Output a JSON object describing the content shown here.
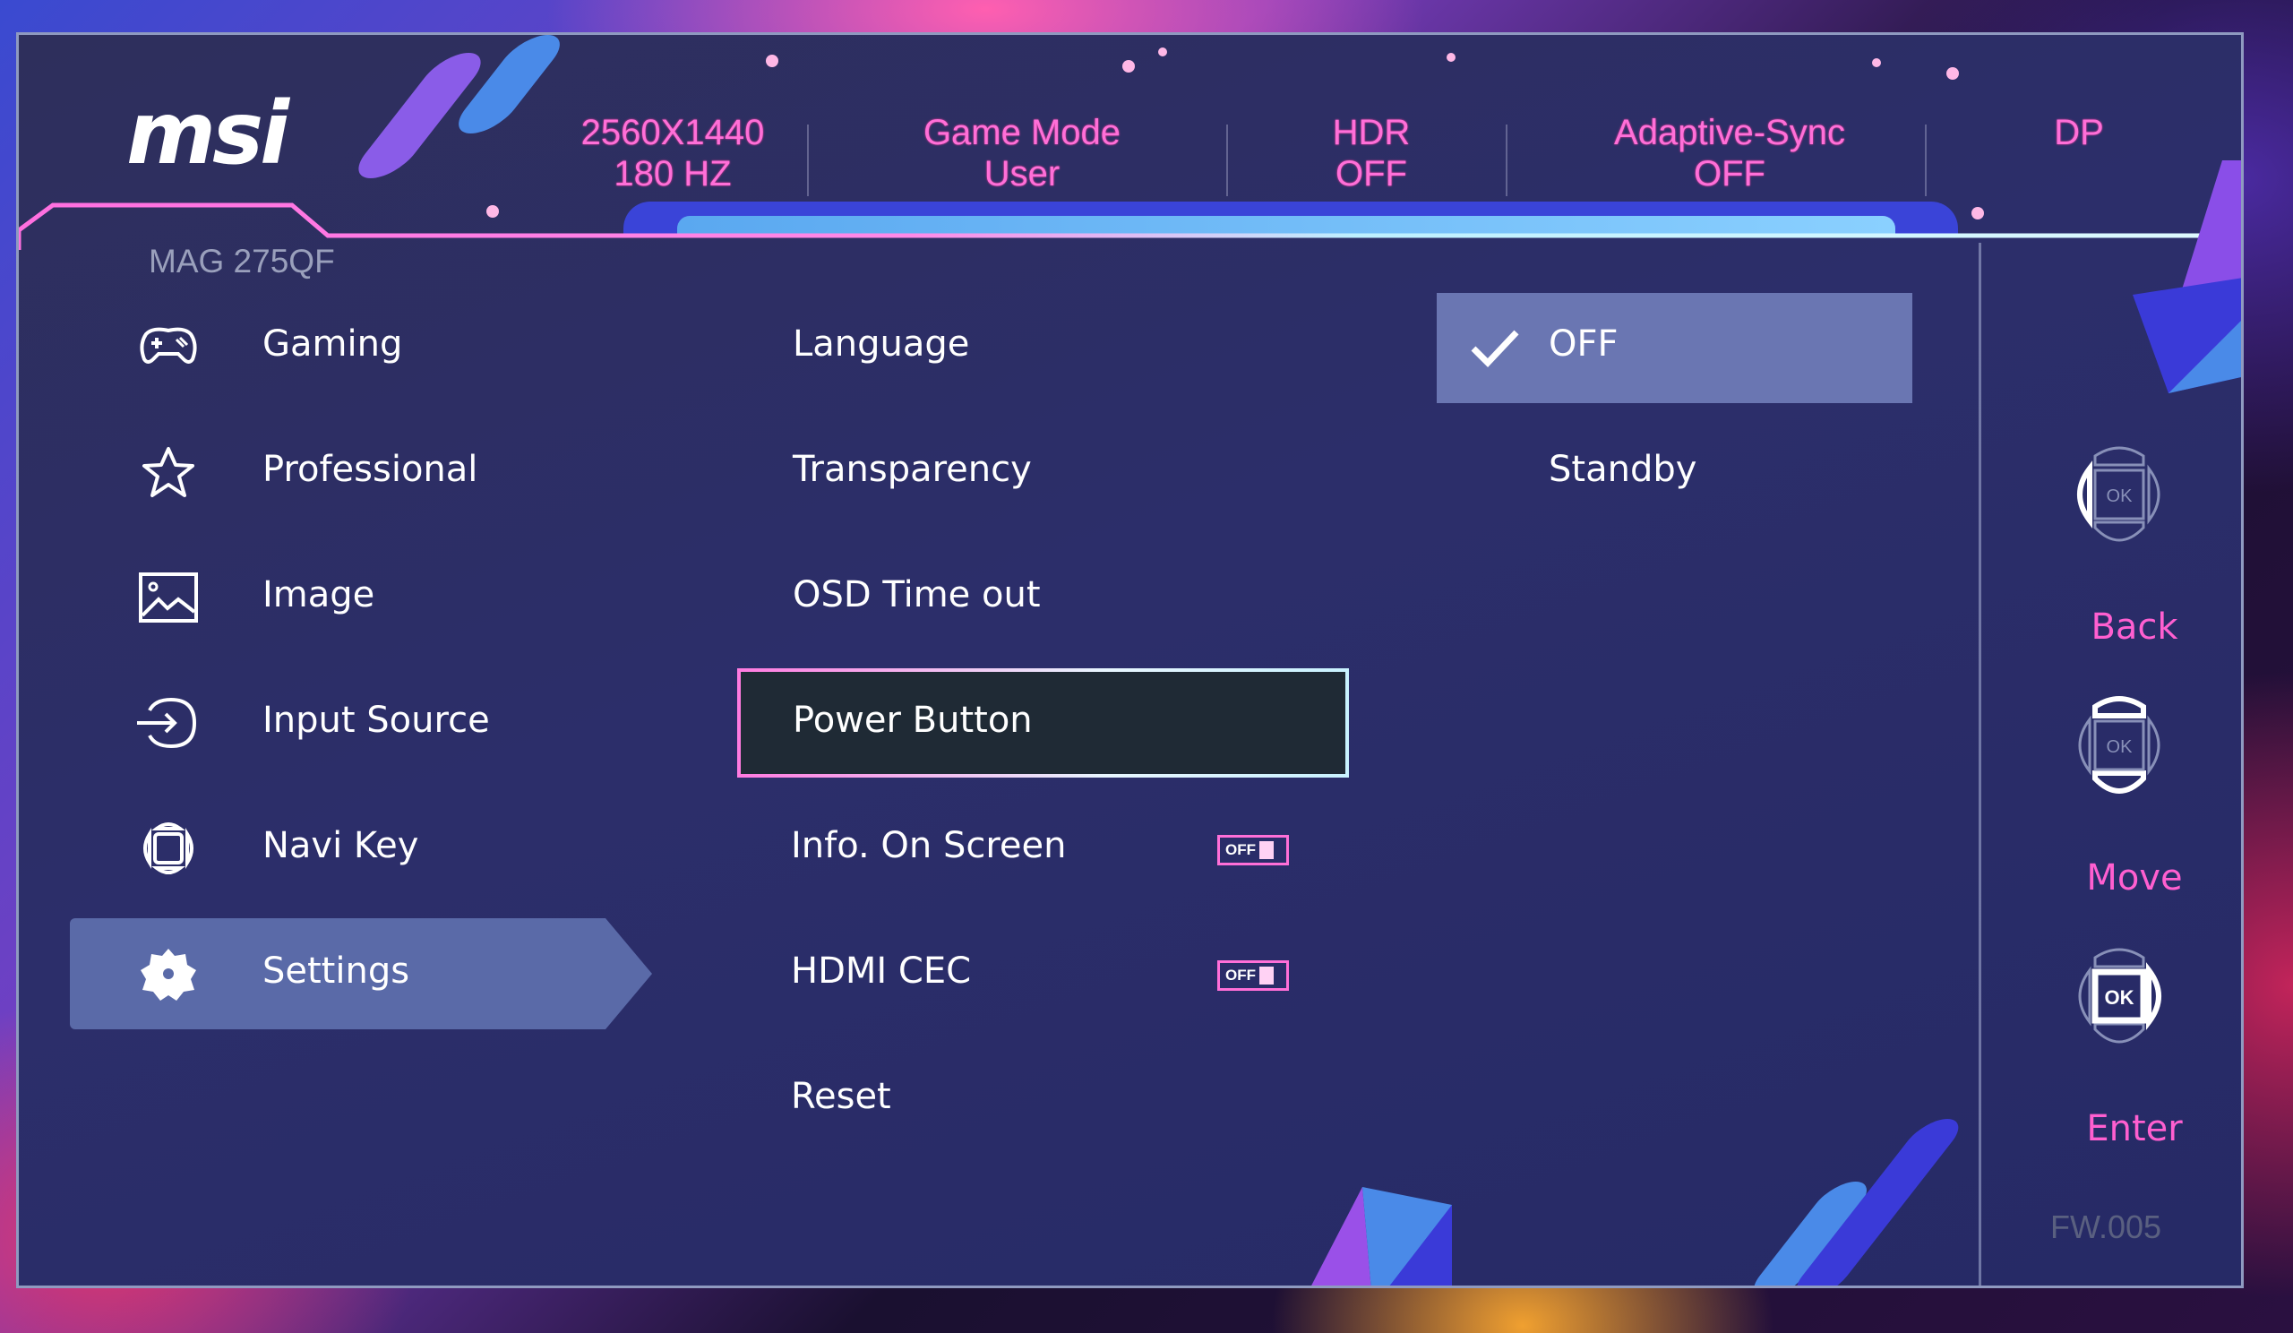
{
  "brand": {
    "logo": "msi",
    "model": "MAG 275QF"
  },
  "status_bar": [
    {
      "line1": "2560X1440",
      "line2": "180 HZ"
    },
    {
      "line1": "Game Mode",
      "line2": "User"
    },
    {
      "line1": "HDR",
      "line2": "OFF"
    },
    {
      "line1": "Adaptive-Sync",
      "line2": "OFF"
    },
    {
      "line1": "DP",
      "line2": ""
    }
  ],
  "main_menu": [
    {
      "label": "Gaming",
      "icon": "gamepad-icon",
      "active": false
    },
    {
      "label": "Professional",
      "icon": "star-icon",
      "active": false
    },
    {
      "label": "Image",
      "icon": "image-icon",
      "active": false
    },
    {
      "label": "Input Source",
      "icon": "input-source-icon",
      "active": false
    },
    {
      "label": "Navi Key",
      "icon": "navi-key-icon",
      "active": false
    },
    {
      "label": "Settings",
      "icon": "gear-icon",
      "active": true
    }
  ],
  "settings_menu": [
    {
      "label": "Language"
    },
    {
      "label": "Transparency"
    },
    {
      "label": "OSD Time out"
    },
    {
      "label": "Power Button",
      "selected": true
    },
    {
      "label": "Info. On Screen",
      "toggle": "OFF"
    },
    {
      "label": "HDMI CEC",
      "toggle": "OFF"
    },
    {
      "label": "Reset"
    }
  ],
  "power_button_options": [
    {
      "label": "OFF",
      "checked": true
    },
    {
      "label": "Standby",
      "checked": false
    }
  ],
  "nav_hints": [
    {
      "label": "Back",
      "icon": "navkey-left-icon"
    },
    {
      "label": "Move",
      "icon": "navkey-updown-icon"
    },
    {
      "label": "Enter",
      "icon": "navkey-ok-icon"
    }
  ],
  "firmware": "FW.005",
  "colors": {
    "accent_pink": "#ff5fd0",
    "panel_bg": "#2c2e6a",
    "highlight": "#5a6aa8",
    "option_highlight": "#6a76b2"
  }
}
